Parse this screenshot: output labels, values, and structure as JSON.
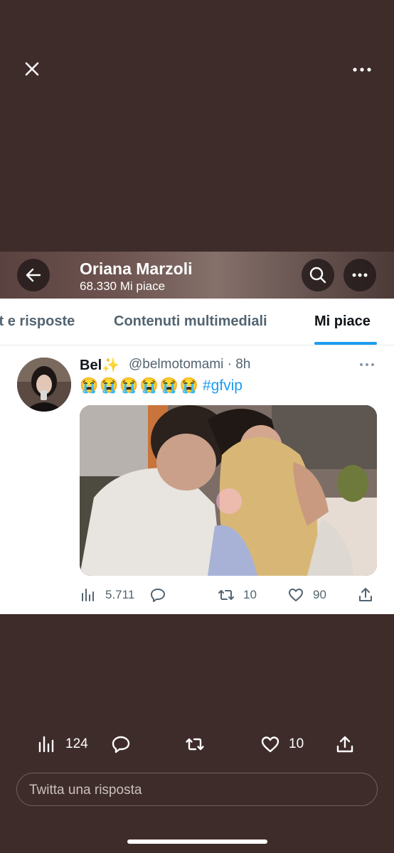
{
  "viewer": {
    "close_icon": "close-icon",
    "more_icon": "more-horizontal-icon"
  },
  "profile_header": {
    "name": "Oriana Marzoli",
    "likes_count": "68.330 Mi piace",
    "back_icon": "arrow-left-icon",
    "search_icon": "search-icon",
    "more_icon": "more-horizontal-icon"
  },
  "tabs": [
    {
      "label": "Tweet e risposte",
      "active": false
    },
    {
      "label": "Contenuti multimediali",
      "active": false
    },
    {
      "label": "Mi piace",
      "active": true
    }
  ],
  "tweet": {
    "display_name": "Bel",
    "name_emoji": "✨",
    "handle_time": "@belmotomami · 8h",
    "emojis": "😭😭😭😭😭😭",
    "hashtag": "#gfvip",
    "stats": {
      "views": "5.711",
      "replies": "",
      "retweets": "10",
      "likes": "90"
    }
  },
  "bottom_actions": {
    "views": "124",
    "likes": "10"
  },
  "reply": {
    "placeholder": "Twitta una risposta"
  },
  "colors": {
    "background": "#3e2c2a",
    "accent": "#1d9bf0",
    "text_primary": "#0f1419",
    "text_secondary": "#536471"
  }
}
